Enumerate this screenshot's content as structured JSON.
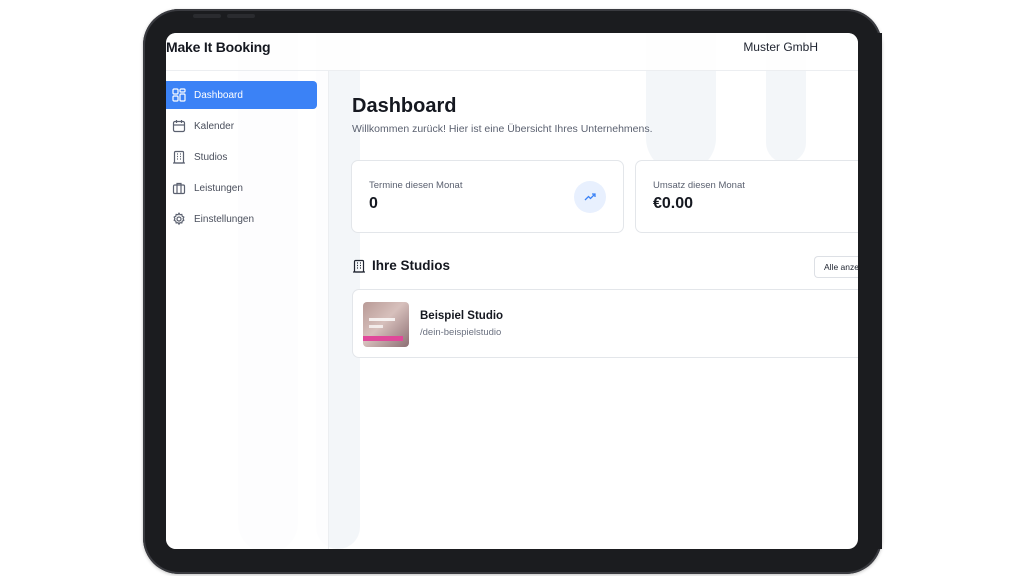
{
  "app": {
    "brand": "Make It Booking",
    "company": "Muster GmbH"
  },
  "sidebar": {
    "items": [
      {
        "label": "Dashboard",
        "icon": "dashboard-grid-icon",
        "active": true
      },
      {
        "label": "Kalender",
        "icon": "calendar-icon",
        "active": false
      },
      {
        "label": "Studios",
        "icon": "building-icon",
        "active": false
      },
      {
        "label": "Leistungen",
        "icon": "briefcase-icon",
        "active": false
      },
      {
        "label": "Einstellungen",
        "icon": "gear-icon",
        "active": false
      }
    ]
  },
  "main": {
    "title": "Dashboard",
    "subtitle": "Willkommen zurück! Hier ist eine Übersicht Ihres Unternehmens.",
    "stats": [
      {
        "label": "Termine diesen Monat",
        "value": "0",
        "icon": "trending-up-icon"
      },
      {
        "label": "Umsatz diesen Monat",
        "value": "€0.00"
      }
    ],
    "studios_section": {
      "title": "Ihre Studios",
      "icon": "building-icon",
      "show_all_label": "Alle anzeigen",
      "items": [
        {
          "name": "Beispiel Studio",
          "slug": "/dein-beispielstudio"
        }
      ]
    }
  },
  "colors": {
    "accent": "#3b82f6",
    "accent_soft": "#e8f0fe",
    "text": "#151820",
    "muted": "#5b6170",
    "border": "#e3e6ea"
  }
}
